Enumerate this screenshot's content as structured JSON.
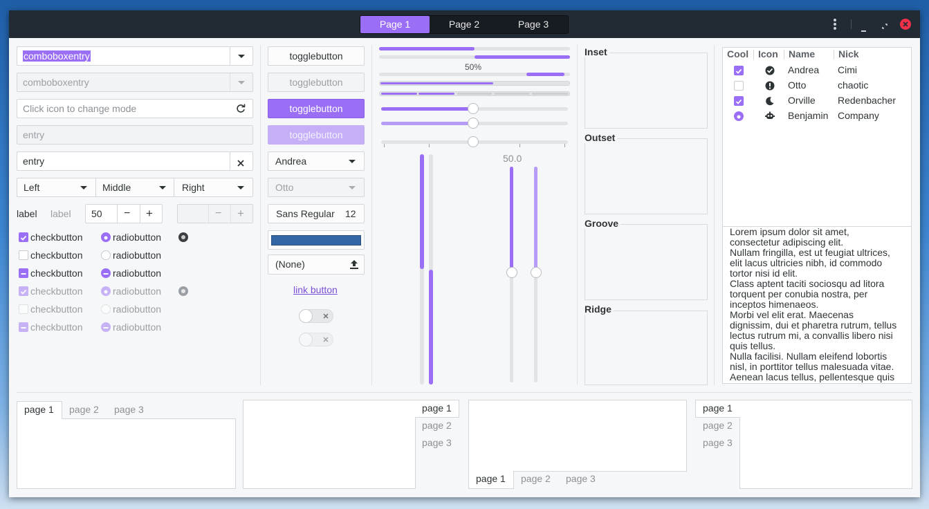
{
  "headerbar": {
    "pages": [
      "Page 1",
      "Page 2",
      "Page 3"
    ],
    "active_page": 0,
    "menu_icon": "kebab-menu-icon",
    "window_buttons": [
      "minimize-icon",
      "restore-icon",
      "close-icon"
    ],
    "close_color": "#f2324a"
  },
  "col1": {
    "combo1": "comboboxentry",
    "combo2": "comboboxentry",
    "entry_placeholder": "Click icon to change mode",
    "entry_disabled": "entry",
    "entry_clear": "entry",
    "align_combos": [
      "Left",
      "Middle",
      "Right"
    ],
    "label1": "label",
    "label2": "label",
    "spin_value": "50",
    "spin_minus": "−",
    "spin_plus": "+",
    "checks": [
      {
        "label": "checkbutton",
        "state": "checked"
      },
      {
        "label": "checkbutton",
        "state": "unchecked"
      },
      {
        "label": "checkbutton",
        "state": "mixed"
      },
      {
        "label": "checkbutton",
        "state": "checked-disabled"
      },
      {
        "label": "checkbutton",
        "state": "unchecked-disabled"
      },
      {
        "label": "checkbutton",
        "state": "mixed-disabled"
      }
    ],
    "radios": [
      {
        "label": "radiobutton",
        "state": "checked"
      },
      {
        "label": "radiobutton",
        "state": "unchecked"
      },
      {
        "label": "radiobutton",
        "state": "mixed"
      },
      {
        "label": "radiobutton",
        "state": "checked-disabled"
      },
      {
        "label": "radiobutton",
        "state": "unchecked-disabled"
      },
      {
        "label": "radiobutton",
        "state": "mixed-disabled"
      }
    ]
  },
  "col2": {
    "toggles": [
      "togglebutton",
      "togglebutton",
      "togglebutton",
      "togglebutton"
    ],
    "combo_name": "Andrea",
    "combo_name_disabled": "Otto",
    "font_name": "Sans Regular",
    "font_size": "12",
    "color_swatch": "#3465a4",
    "file_button": "(None)",
    "link": "link button"
  },
  "col3": {
    "progress_label": "50%",
    "progress_top": 0.5,
    "scale_h1": 0.5,
    "scale_h2": 0.5,
    "scale_h3": 0.5,
    "scale_value_label": "50.0",
    "vscale1": 0.5,
    "vscale2": 0.5
  },
  "frames": [
    "Inset",
    "Outset",
    "Groove",
    "Ridge"
  ],
  "tree": {
    "columns": [
      "Cool",
      "Icon",
      "Name",
      "Nick"
    ],
    "rows": [
      {
        "cool": "checked",
        "icon": "check-circle-icon",
        "name": "Andrea",
        "nick": "Cimi"
      },
      {
        "cool": "unchecked",
        "icon": "alert-circle-icon",
        "name": "Otto",
        "nick": "chaotic"
      },
      {
        "cool": "checked",
        "icon": "moon-icon",
        "name": "Orville",
        "nick": "Redenbacher"
      },
      {
        "cool": "radio",
        "icon": "robot-icon",
        "name": "Benjamin",
        "nick": "Company"
      }
    ]
  },
  "textview": [
    "Lorem ipsum dolor sit amet,",
    "consectetur adipiscing elit.",
    "Nullam fringilla, est ut feugiat ultrices,",
    "elit lacus ultricies nibh, id commodo",
    "tortor nisi id elit.",
    "Class aptent taciti sociosqu ad litora",
    "torquent per conubia nostra, per",
    "inceptos himenaeos.",
    "Morbi vel elit erat. Maecenas",
    "dignissim, dui et pharetra rutrum, tellus",
    "lectus rutrum mi, a convallis libero nisi",
    "quis tellus.",
    "Nulla facilisi. Nullam eleifend lobortis",
    "nisl, in porttitor tellus malesuada vitae.",
    "Aenean lacus tellus, pellentesque quis"
  ],
  "notebooks": {
    "tabs": [
      "page 1",
      "page 2",
      "page 3"
    ]
  },
  "accent": "#9b6ff5"
}
